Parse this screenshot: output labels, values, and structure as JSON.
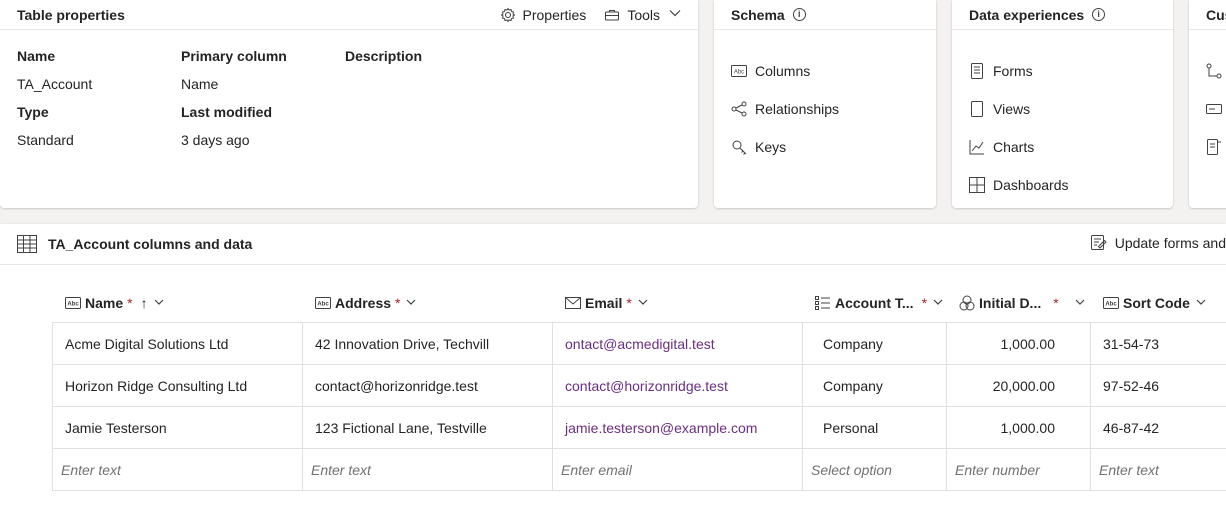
{
  "props": {
    "title": "Table properties",
    "properties_label": "Properties",
    "tools_label": "Tools",
    "name_label": "Name",
    "name_value": "TA_Account",
    "primary_label": "Primary column",
    "primary_value": "Name",
    "description_label": "Description",
    "type_label": "Type",
    "type_value": "Standard",
    "modified_label": "Last modified",
    "modified_value": "3 days ago"
  },
  "schema": {
    "title": "Schema",
    "items": [
      {
        "label": "Columns",
        "icon": "text-column-icon"
      },
      {
        "label": "Relationships",
        "icon": "relationship-icon"
      },
      {
        "label": "Keys",
        "icon": "key-icon"
      }
    ]
  },
  "dataexp": {
    "title": "Data experiences",
    "items": [
      {
        "label": "Forms",
        "icon": "form-icon"
      },
      {
        "label": "Views",
        "icon": "view-icon"
      },
      {
        "label": "Charts",
        "icon": "chart-icon"
      },
      {
        "label": "Dashboards",
        "icon": "dashboard-icon"
      }
    ]
  },
  "custom": {
    "title": "Cus"
  },
  "datapanel": {
    "title": "TA_Account columns and data",
    "update_label": "Update forms and"
  },
  "columns": [
    {
      "label": "Name",
      "sort": "↑"
    },
    {
      "label": "Address"
    },
    {
      "label": "Email"
    },
    {
      "label": "Account T..."
    },
    {
      "label": "Initial D..."
    },
    {
      "label": "Sort Code"
    }
  ],
  "rows": [
    [
      "Acme Digital Solutions Ltd",
      "42 Innovation Drive, Techvill",
      "ontact@acmedigital.test",
      "Company",
      "1,000.00",
      "31-54-73"
    ],
    [
      "Horizon Ridge Consulting Ltd",
      "contact@horizonridge.test",
      "contact@horizonridge.test",
      "Company",
      "20,000.00",
      "97-52-46"
    ],
    [
      "Jamie Testerson",
      "123 Fictional Lane, Testville",
      "jamie.testerson@example.com",
      "Personal",
      "1,000.00",
      "46-87-42"
    ]
  ],
  "placeholders": [
    "Enter text",
    "Enter text",
    "Enter email",
    "Select option",
    "Enter number",
    "Enter text"
  ],
  "colors": {
    "link": "#6b2e82",
    "required": "#a4262c"
  }
}
